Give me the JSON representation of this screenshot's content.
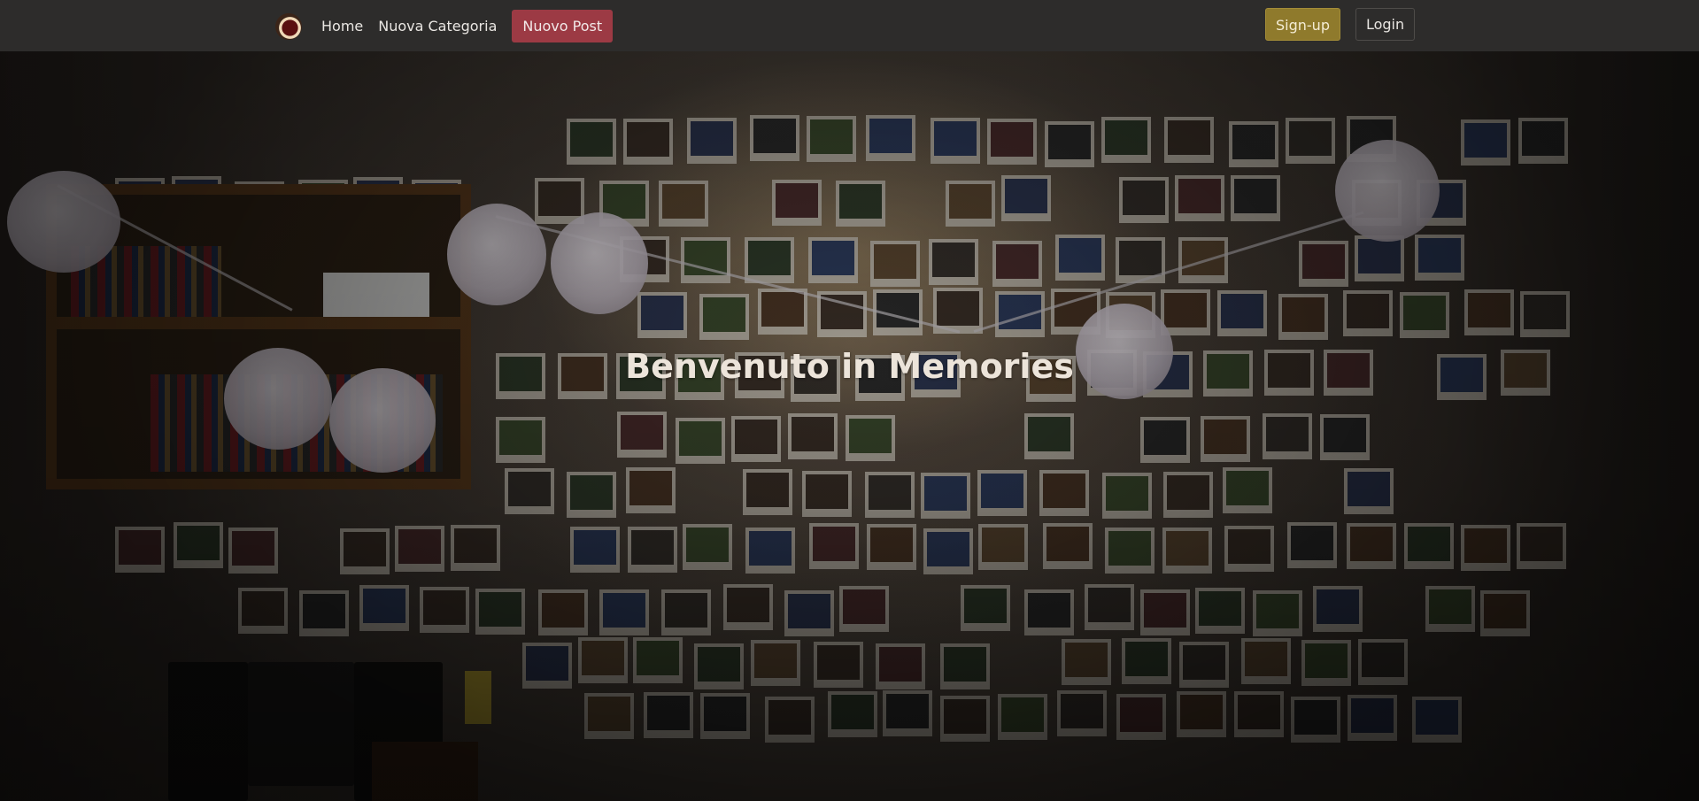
{
  "navbar": {
    "logo_icon": "memories-logo-icon",
    "links": [
      "Home",
      "Nuova Categoria"
    ],
    "new_post_label": "Nuovo Post",
    "signup_label": "Sign-up",
    "login_label": "Login"
  },
  "hero": {
    "title": "Benvenuto in Memories",
    "background": "room-wall-with-polaroids-and-lanterns"
  },
  "colors": {
    "navbar_bg": "#2d2c2b",
    "new_post_bg": "#9c3a44",
    "signup_bg": "#8f7a2c",
    "login_border": "#4e4c49",
    "title_color": "#ece4da"
  }
}
